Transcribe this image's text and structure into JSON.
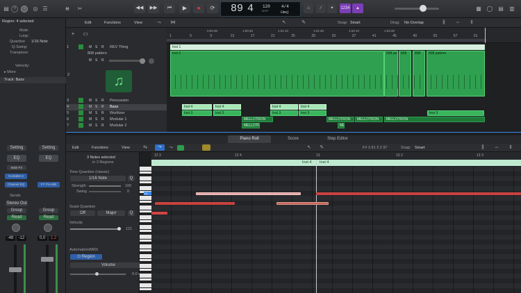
{
  "app": {
    "lcd": {
      "bar": "89",
      "beat": "4",
      "tempo": "120",
      "tempo_label": "KEEP",
      "sig": "4/4",
      "key": "Cmaj"
    },
    "toolbar": {
      "cpu_label": "CPU"
    }
  },
  "inspector": {
    "region_header": "Region: 4 selected",
    "rows": [
      "Mute:",
      "Loop:",
      "Quantize",
      "Q-Swing:",
      "Transpose:",
      "Velocity:"
    ],
    "quantize_val": "1/16 Note",
    "more": "More",
    "track_header": "Track: Bass",
    "strip_left": {
      "setting": "Setting",
      "eq": "EQ",
      "plugin": "MIDI FX",
      "inst": "Kontakte 6",
      "chan": "Channel EQ",
      "sends": "Sends",
      "out": "Stereo Out",
      "group": "Group",
      "read": "Read",
      "val1": "-48",
      "val2": "-12"
    },
    "strip_right": {
      "setting": "Setting",
      "eq": "EQ",
      "inst": "FF Pro-MB",
      "out": "Stereo",
      "group": "Group",
      "read": "Read",
      "val1": "0,0",
      "val2": "1.2"
    }
  },
  "tracks_menu": {
    "edit": "Edit",
    "functions": "Functions",
    "view": "View",
    "snap_label": "Snap:",
    "snap": "Smart",
    "drag_label": "Drag:",
    "drag": "No Overlap"
  },
  "ruler": [
    "1",
    "5",
    "9",
    "13",
    "17",
    "21",
    "25",
    "29",
    "33",
    "37",
    "41",
    "45",
    "49",
    "53",
    "57",
    "61"
  ],
  "ruler_times": [
    "0:00:30",
    "1:00:40",
    "1:01:10",
    "1:01:40",
    "1:02:10",
    "1:02:40"
  ],
  "tracks": [
    {
      "num": "1",
      "name": "REV Thing"
    },
    {
      "num": "",
      "name": "808 pattern"
    },
    {
      "num": "2",
      "name": ""
    },
    {
      "num": "3",
      "name": "Percussion"
    },
    {
      "num": "4",
      "name": "Bass"
    },
    {
      "num": "5",
      "name": "Wurlitzer"
    },
    {
      "num": "6",
      "name": "Modular 1"
    },
    {
      "num": "7",
      "name": "Modular 2"
    }
  ],
  "regions": {
    "r1": "Inst 1",
    "r2a": "Inst 2",
    "r2b": "808 pa",
    "r2c": "808",
    "r2d": "808",
    "r2e": "808 pattern",
    "bass": [
      "Inst 4",
      "Inst 4",
      "Inst 4",
      "Inst 4"
    ],
    "wurl": [
      "Inst 3",
      "Inst 3",
      "Inst 3",
      "Inst 3"
    ],
    "wurl2": "Inst 3",
    "mod1": [
      "MELLOTRON",
      "MELLOTRON",
      "MELLOTRON",
      "MELLOTRON"
    ],
    "mod2": [
      "MELLOTR",
      "ME"
    ]
  },
  "editor": {
    "tabs": [
      "Piano Roll",
      "Score",
      "Step Editor"
    ],
    "edit": "Edit",
    "functions": "Functions",
    "view": "View",
    "pos": "F# 3  91 3 2 97",
    "snap_label": "Snap:",
    "snap": "Smart",
    "sel": "3 Notes selected",
    "sel_sub": "in 3 Regions",
    "tq_label": "Time Quantize (classic)",
    "tq_val": "1/16 Note",
    "q_btn": "Q",
    "strength": "Strength",
    "strength_val": "100",
    "swing": "Swing",
    "swing_val": "0",
    "sq_label": "Scale Quantize",
    "sq_off": "Off",
    "sq_major": "Major",
    "sq_q": "Q",
    "velocity": "Velocity",
    "vel_val": "121",
    "auto_label": "Automation/MIDI",
    "auto_region": "Region",
    "auto_param": "Volume",
    "auto_val": "0.0 dB",
    "ruler": [
      "12 3",
      "12 4",
      "13",
      "13 2",
      "13 3"
    ],
    "region_a": "Inst 4",
    "region_b": "Inst 4",
    "c2": "C2"
  },
  "colors": {
    "green": "#39b55c",
    "accent": "#3d8cf0",
    "note_red": "#d24444"
  }
}
